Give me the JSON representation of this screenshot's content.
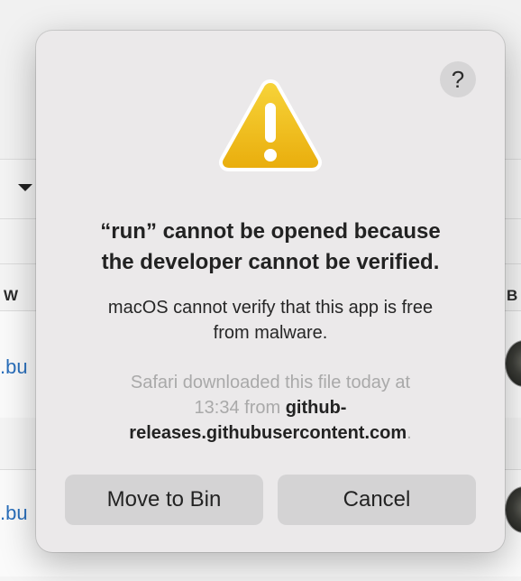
{
  "background": {
    "column_left_header": "W",
    "column_right_header": "B",
    "rows": [
      {
        "link_text": ".bu"
      },
      {
        "link_text": ".bu"
      }
    ]
  },
  "dialog": {
    "help_label": "?",
    "icon": "warning-icon",
    "title_line1": "“run” cannot be opened because",
    "title_line2": "the developer cannot be verified.",
    "message_line1": "macOS cannot verify that this app is free",
    "message_line2": "from malware.",
    "source_line1": "Safari downloaded this file today at",
    "source_time_from": "13:34 from",
    "source_domain_part1": "github-",
    "source_domain_part2": "releases.githubusercontent.com",
    "source_end": ".",
    "buttons": {
      "move_to_bin": "Move to Bin",
      "cancel": "Cancel"
    }
  },
  "colors": {
    "dialog_bg": "#ebe9ea",
    "button_bg": "#d4d3d4",
    "warning_yellow": "#f2c218",
    "link_blue": "#2a6fbb"
  }
}
